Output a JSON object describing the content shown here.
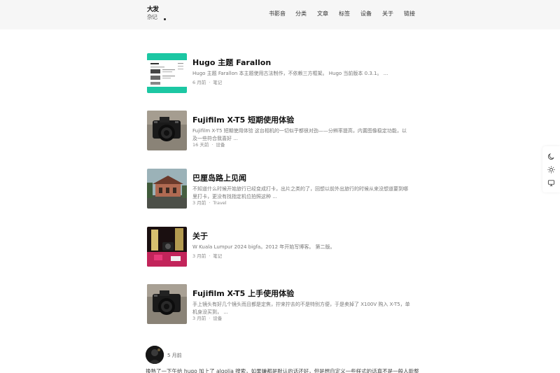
{
  "header": {
    "logo_line1": "大发",
    "logo_line2": "杂记",
    "nav": [
      {
        "label": "书影音"
      },
      {
        "label": "分类"
      },
      {
        "label": "文章"
      },
      {
        "label": "标签"
      },
      {
        "label": "设备"
      },
      {
        "label": "关于"
      },
      {
        "label": "链接"
      }
    ]
  },
  "posts": [
    {
      "title": "Hugo 主题 Farallon",
      "excerpt": "Hugo 主题 Farallon 本主题使用古法制作，不依赖三方框架。 Hugo 当前版本 0.3.1。 ...",
      "time": "6 月前",
      "category": "笔记"
    },
    {
      "title": "Fujifilm X-T5 短期使用体验",
      "excerpt": "Fujifilm X-T5 短期使用体验 这台相机的一切似乎都很对劲——分辨率提高，内置图像稳定功能，以及一些符合我喜好 ...",
      "time": "16 天前",
      "category": "设备"
    },
    {
      "title": "巴厘岛路上见闻",
      "excerpt": "不知道什么时候开始旅行已经变成打卡，出片之类的了，回想以前外出旅行的时候从来没想道要到哪里打卡，更没有找指定机位拍照这种 ...",
      "time": "3 月前",
      "category": "Travel"
    },
    {
      "title": "关于",
      "excerpt": "W Kuala Lumpur 2024 bigfa。2012 年开始写博客。 第二版。",
      "time": "3 月前",
      "category": "笔记"
    },
    {
      "title": "Fujifilm X-T5 上手使用体验",
      "excerpt": "手上镜头有好几个镜头而且都是定焦，拧来拧去的不是特别方便，于是卖掉了 X100V 购入 X-T5，单机身没买到， ...",
      "time": "3 月前",
      "category": "设备"
    }
  ],
  "sidebar": {
    "buttons": [
      {
        "icon": "moon-icon"
      },
      {
        "icon": "sun-icon"
      },
      {
        "icon": "monitor-icon"
      }
    ]
  },
  "memo": {
    "time": "5 月前",
    "text": "换熟了一下午给 hugo 加上了 algolia 搜索，如果嫌都是默认的话还好，但是想自定义一些样式的话真不是一般人能整"
  },
  "colors": {
    "header_bg": "#f6f6f6",
    "title": "#111111",
    "excerpt": "#777777",
    "meta": "#888888",
    "farallon_teal": "#1cc7a3"
  }
}
